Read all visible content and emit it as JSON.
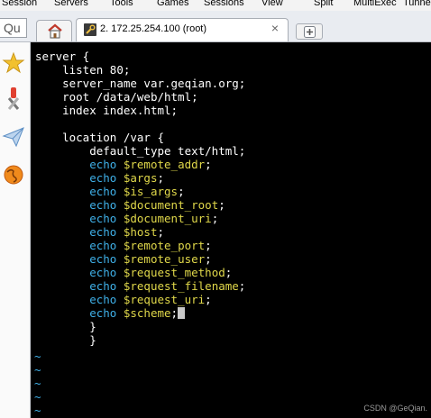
{
  "menubar": {
    "items": [
      "Session",
      "Servers",
      "Tools",
      "Games",
      "Sessions",
      "View",
      "Split",
      "MultiExec",
      "Tunnel"
    ]
  },
  "tabbar": {
    "quick_connect_text": "Qu",
    "session_tab_label": "2. 172.25.254.100 (root)",
    "close_glyph": "×"
  },
  "terminal": {
    "lines": [
      {
        "indent": "",
        "kw": "",
        "text": "server {",
        "var": "",
        "tail": ""
      },
      {
        "indent": "    ",
        "kw": "",
        "text": "listen 80;",
        "var": "",
        "tail": ""
      },
      {
        "indent": "    ",
        "kw": "",
        "text": "server_name var.geqian.org;",
        "var": "",
        "tail": ""
      },
      {
        "indent": "    ",
        "kw": "",
        "text": "root /data/web/html;",
        "var": "",
        "tail": ""
      },
      {
        "indent": "    ",
        "kw": "",
        "text": "index index.html;",
        "var": "",
        "tail": ""
      },
      {
        "indent": "",
        "kw": "",
        "text": "",
        "var": "",
        "tail": ""
      },
      {
        "indent": "    ",
        "kw": "",
        "text": "location /var {",
        "var": "",
        "tail": ""
      },
      {
        "indent": "        ",
        "kw": "",
        "text": "default_type text/html;",
        "var": "",
        "tail": ""
      },
      {
        "indent": "        ",
        "kw": "echo",
        "text": "",
        "var": "$remote_addr",
        "tail": ";"
      },
      {
        "indent": "        ",
        "kw": "echo",
        "text": "",
        "var": "$args",
        "tail": ";"
      },
      {
        "indent": "        ",
        "kw": "echo",
        "text": "",
        "var": "$is_args",
        "tail": ";"
      },
      {
        "indent": "        ",
        "kw": "echo",
        "text": "",
        "var": "$document_root",
        "tail": ";"
      },
      {
        "indent": "        ",
        "kw": "echo",
        "text": "",
        "var": "$document_uri",
        "tail": ";"
      },
      {
        "indent": "        ",
        "kw": "echo",
        "text": "",
        "var": "$host",
        "tail": ";"
      },
      {
        "indent": "        ",
        "kw": "echo",
        "text": "",
        "var": "$remote_port",
        "tail": ";"
      },
      {
        "indent": "        ",
        "kw": "echo",
        "text": "",
        "var": "$remote_user",
        "tail": ";"
      },
      {
        "indent": "        ",
        "kw": "echo",
        "text": "",
        "var": "$request_method",
        "tail": ";"
      },
      {
        "indent": "        ",
        "kw": "echo",
        "text": "",
        "var": "$request_filename",
        "tail": ";"
      },
      {
        "indent": "        ",
        "kw": "echo",
        "text": "",
        "var": "$request_uri",
        "tail": ";"
      },
      {
        "indent": "        ",
        "kw": "echo",
        "text": "",
        "var": "$scheme",
        "tail": ";",
        "cursor": true
      },
      {
        "indent": "        ",
        "kw": "",
        "text": "}",
        "var": "",
        "tail": ""
      },
      {
        "indent": "        ",
        "kw": "",
        "text": "}",
        "var": "",
        "tail": ""
      }
    ],
    "tilde_char": "~",
    "tilde_count": 5
  },
  "watermark": "CSDN @GeQian.",
  "colors": {
    "keyword": "#3fb0e8",
    "variable": "#e0d84a",
    "text": "#ffffff",
    "background": "#000000"
  },
  "icons": {
    "home_tab": "home-icon",
    "session_tab": "wrench-icon",
    "new_tab": "plus-icon",
    "sidebar": [
      "star-icon",
      "tools-icon",
      "paper-plane-icon",
      "globe-icon"
    ]
  }
}
